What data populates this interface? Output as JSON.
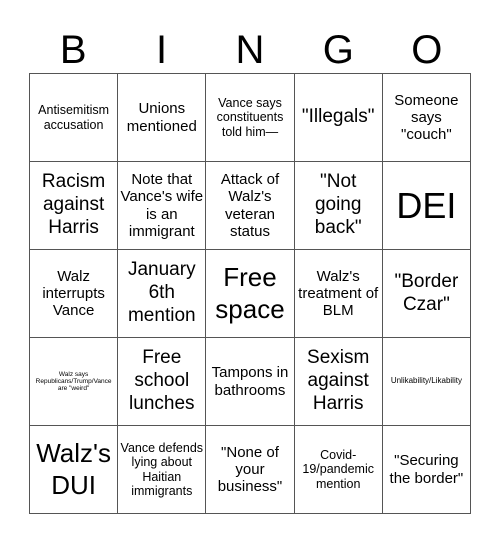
{
  "header": {
    "letters": [
      "B",
      "I",
      "N",
      "G",
      "O"
    ]
  },
  "board": {
    "rows": [
      [
        "Antisemitism accusation",
        "Unions mentioned",
        "Vance says constituents told him—",
        "\"Illegals\"",
        "Someone says \"couch\""
      ],
      [
        "Racism against Harris",
        "Note that Vance's wife is an immigrant",
        "Attack of Walz's veteran status",
        "\"Not going back\"",
        "DEI"
      ],
      [
        "Walz interrupts Vance",
        "January 6th mention",
        "Free space",
        "Walz's treatment of BLM",
        "\"Border Czar\""
      ],
      [
        "Walz says Republicans/Trump/Vance are \"weird\"",
        "Free school lunches",
        "Tampons in bathrooms",
        "Sexism against Harris",
        "Unlikability/Likability"
      ],
      [
        "Walz's DUI",
        "Vance defends lying about Haitian immigrants",
        "\"None of your business\"",
        "Covid-19/pandemic mention",
        "\"Securing the border\""
      ]
    ]
  }
}
